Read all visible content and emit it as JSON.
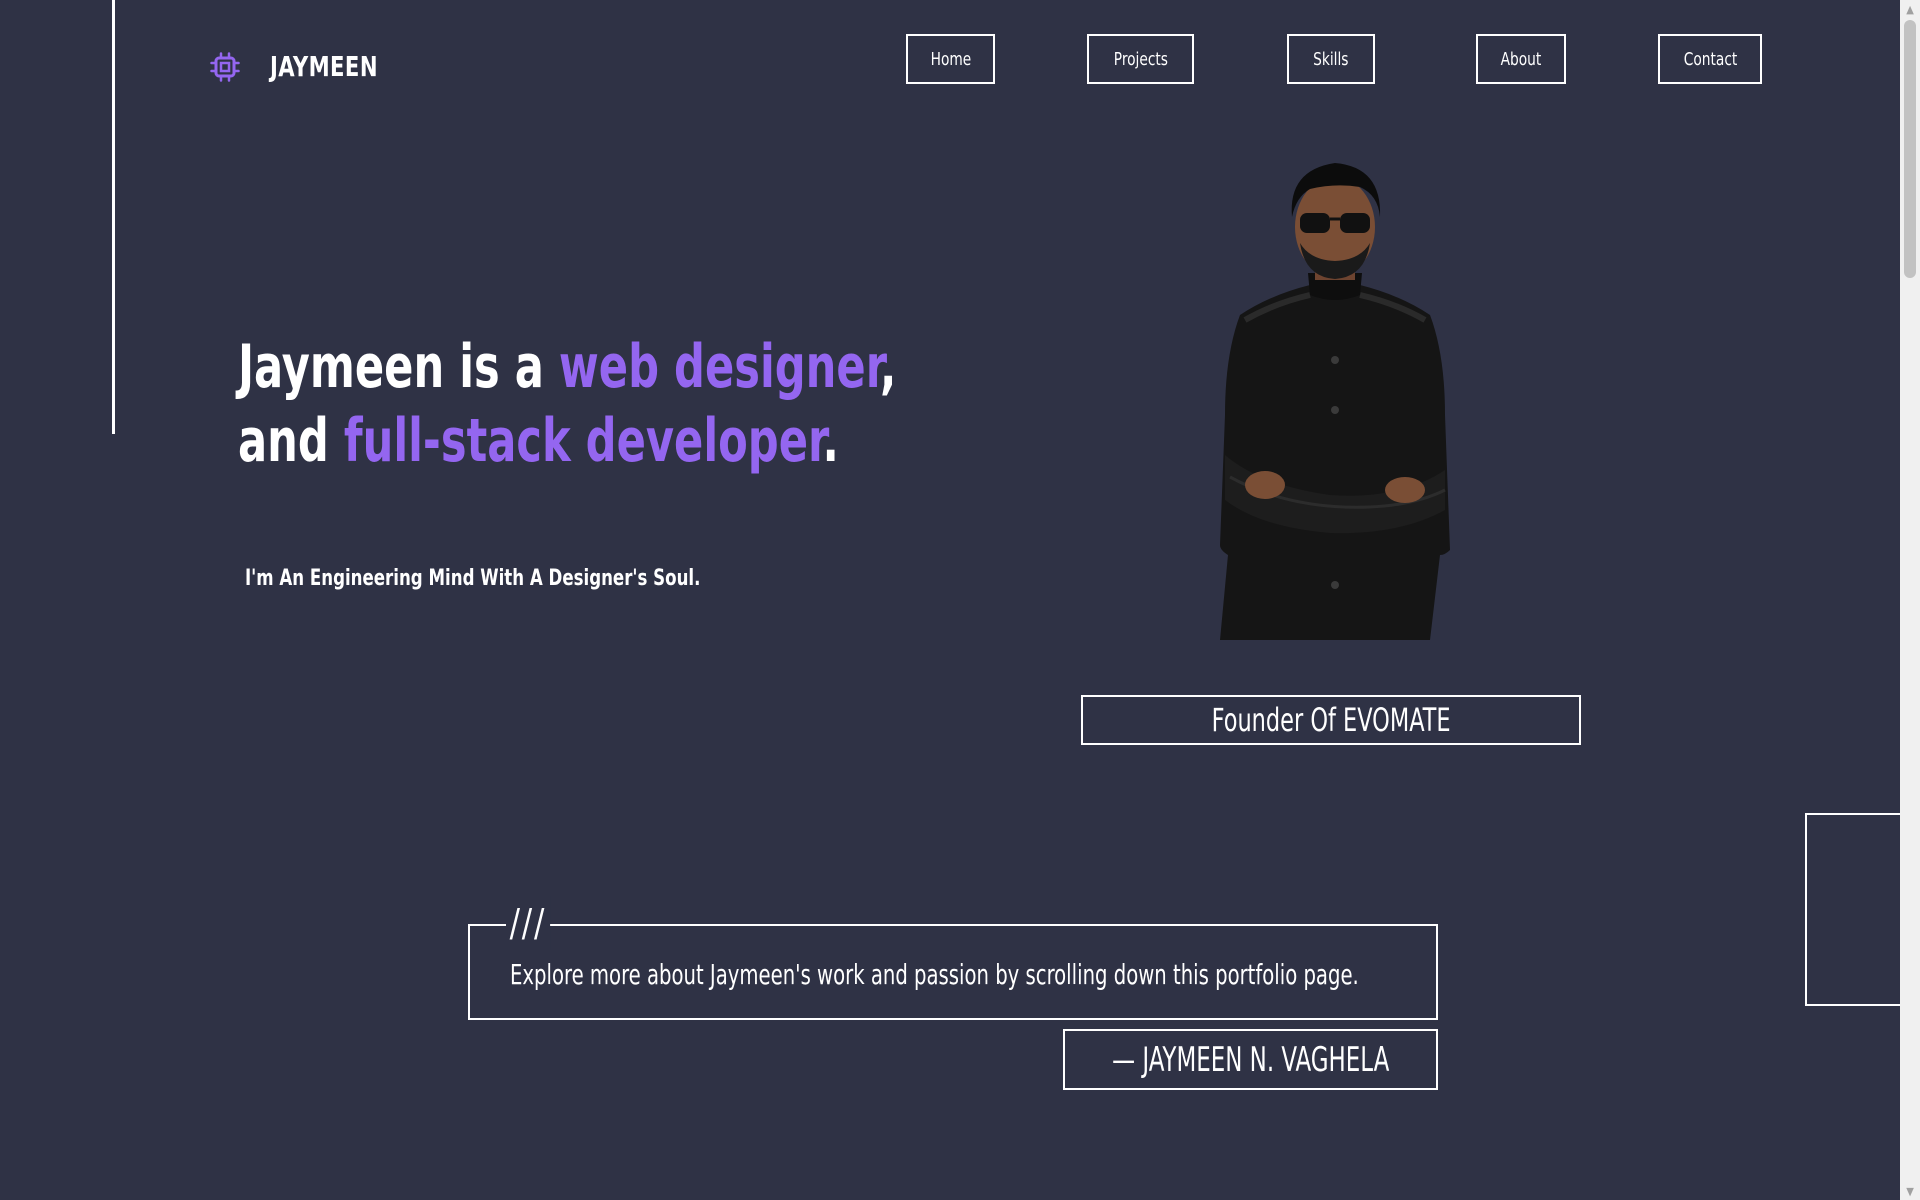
{
  "brand": {
    "name": "JAYMEEN",
    "icon": "cpu-chip-icon",
    "accent_color": "#9466f0"
  },
  "nav": {
    "items": [
      {
        "label": "Home"
      },
      {
        "label": "Projects"
      },
      {
        "label": "Skills"
      },
      {
        "label": "About"
      },
      {
        "label": "Contact"
      }
    ]
  },
  "hero": {
    "line1_prefix": "Jaymeen is a ",
    "line1_accent": "web designer",
    "line1_suffix": ",",
    "line2_prefix": "and ",
    "line2_accent": "full-stack developer",
    "line2_suffix": ".",
    "tagline": "I'm An Engineering Mind With A Designer's Soul.",
    "founder": "Founder Of EVOMATE"
  },
  "quote": {
    "mark": "///",
    "text": "Explore more about Jaymeen's work and passion by scrolling down this portfolio page.",
    "author": "— JAYMEEN N. VAGHELA"
  },
  "colors": {
    "background": "#2f3245",
    "text": "#ffffff",
    "accent": "#9466f0"
  }
}
